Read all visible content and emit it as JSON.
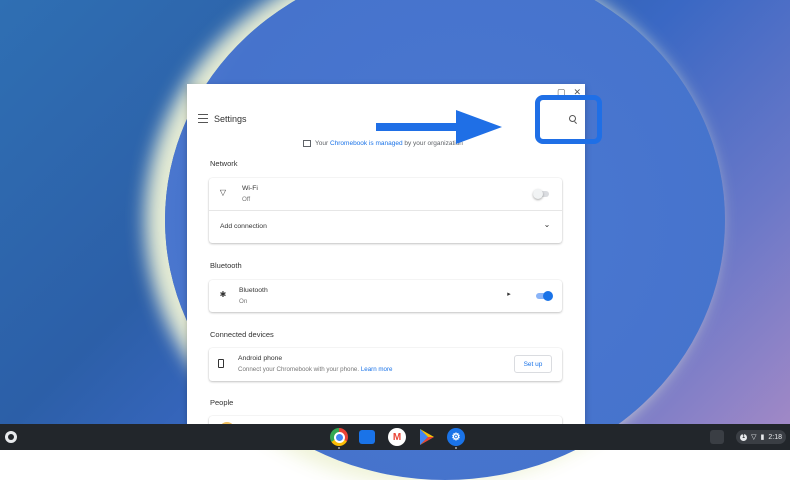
{
  "window": {
    "title": "Settings",
    "controls": {
      "minimize": "▢",
      "close": "✕"
    },
    "managed": {
      "prefix": "Your ",
      "link": "Chromebook is managed",
      "suffix": " by your organization"
    }
  },
  "sections": {
    "network": {
      "heading": "Network",
      "wifi": {
        "label": "Wi-Fi",
        "status": "Off",
        "toggle_on": false
      },
      "add_connection": "Add connection"
    },
    "bluetooth": {
      "heading": "Bluetooth",
      "item": {
        "label": "Bluetooth",
        "status": "On",
        "toggle_on": true
      }
    },
    "connected_devices": {
      "heading": "Connected devices",
      "android": {
        "label": "Android phone",
        "description": "Connect your Chromebook with your phone.",
        "link": "Learn more",
        "button": "Set up"
      }
    },
    "people": {
      "heading": "People"
    }
  },
  "shelf": {
    "apps": [
      "chrome-icon",
      "files-icon",
      "gmail-icon",
      "play-store-icon",
      "settings-icon"
    ],
    "time": "2:18",
    "status_badge": "1"
  },
  "annotation": {
    "color": "#1f6fe6"
  },
  "colors": {
    "accent": "#1a73e8",
    "shelf": "#22262b"
  }
}
